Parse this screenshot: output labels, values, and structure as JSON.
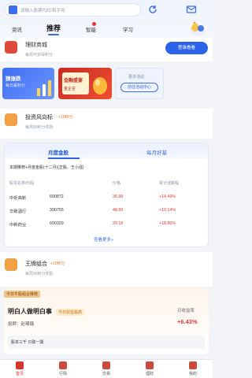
{
  "header": {
    "search_placeholder": "请输入股票代码/首字母",
    "tabs": [
      {
        "label": "资讯"
      },
      {
        "label": "推荐"
      },
      {
        "label": "智能"
      },
      {
        "label": "学习"
      }
    ]
  },
  "top_card": {
    "title": "理财商城",
    "subtitle": "每周可获得积分",
    "button": "登录看看"
  },
  "promos": [
    {
      "title": "猜涨跌",
      "subtitle": "每日赢积分"
    },
    {
      "title": "金融盛宴",
      "subtitle": "金企言"
    },
    {
      "title": "更多活动",
      "button": "前往活动中心"
    }
  ],
  "section_invest": {
    "title": "投资风向标",
    "tag": "+10积分",
    "subtitle": "每周90积分奖励"
  },
  "table_card": {
    "tabs": [
      "月度金股",
      "每月好基"
    ],
    "note": "本期推荐+月度金股(十二月)(正股、王小强)",
    "headers": [
      "股票名称/代码",
      "",
      "价格",
      "累计涨跌幅"
    ],
    "rows": [
      {
        "name": "中炬高新",
        "code": "600872",
        "price": "36.98",
        "change": "+14.49%"
      },
      {
        "name": "华致酒行",
        "code": "300755",
        "price": "48.99",
        "change": "+10.14%"
      },
      {
        "name": "中新药业",
        "code": "600329",
        "price": "29.18",
        "change": "+18.86%"
      }
    ],
    "more": "查看更多»"
  },
  "section_portfolio": {
    "title": "王牌组合",
    "tag": "+20积分",
    "subtitle": "每周90积分奖励"
  },
  "bottom_card": {
    "badge": "今日牛股组合推荐",
    "title": "明白人做明白事",
    "title_tag": "今日收益最高",
    "investor": "投顾：赵珺璐",
    "yield_label": "日收益率",
    "yield_value": "+6.43%",
    "memo": "股本三千 只取一瓢"
  },
  "nav": [
    {
      "label": "首页"
    },
    {
      "label": "行情"
    },
    {
      "label": "交易"
    },
    {
      "label": "理财"
    },
    {
      "label": "我的"
    }
  ],
  "colors": {
    "accent": "#2d63e8",
    "up": "#e53935",
    "brand": "#d9342b"
  }
}
